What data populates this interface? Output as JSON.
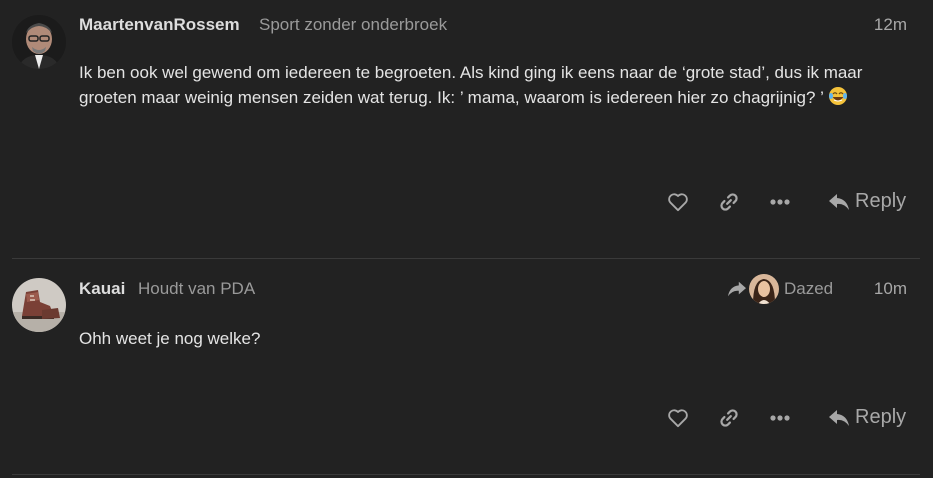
{
  "posts": [
    {
      "username": "MaartenvanRossem",
      "user_title": "Sport zonder onderbroek",
      "time": "12m",
      "body": "Ik ben ook wel gewend om iedereen te begroeten. Als kind ging ik eens naar de ‘grote stad’, dus ik maar groeten maar weinig mensen zeiden wat terug. Ik: ’ mama, waarom is iedereen hier zo chagrijnig? ’",
      "emoji": "joy-emoji",
      "reply_label": "Reply"
    },
    {
      "username": "Kauai",
      "user_title": "Houdt van PDA",
      "time": "10m",
      "reply_to_user": "Dazed",
      "body": "Ohh weet je nog welke?",
      "reply_label": "Reply"
    }
  ],
  "icons": {
    "like": "heart-icon",
    "link": "link-icon",
    "more": "ellipsis-icon",
    "reply": "reply-arrow-icon"
  },
  "colors": {
    "background": "#222222",
    "text": "#dddddd",
    "muted": "#a8a8a8"
  }
}
